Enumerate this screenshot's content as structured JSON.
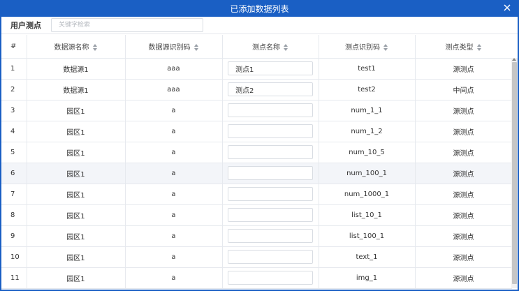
{
  "dialog": {
    "title": "已添加数据列表",
    "close_icon": "close-icon"
  },
  "toolbar": {
    "label": "用户测点",
    "search_placeholder": "关键字检索",
    "search_value": ""
  },
  "table": {
    "columns": [
      "#",
      "数据源名称",
      "数据源识别码",
      "测点名称",
      "测点识别码",
      "测点类型"
    ],
    "rows": [
      {
        "index": "1",
        "source_name": "数据源1",
        "source_code": "aaa",
        "point_name": "测点1",
        "point_code": "test1",
        "point_type": "源测点"
      },
      {
        "index": "2",
        "source_name": "数据源1",
        "source_code": "aaa",
        "point_name": "测点2",
        "point_code": "test2",
        "point_type": "中间点"
      },
      {
        "index": "3",
        "source_name": "园区1",
        "source_code": "a",
        "point_name": "",
        "point_code": "num_1_1",
        "point_type": "源测点"
      },
      {
        "index": "4",
        "source_name": "园区1",
        "source_code": "a",
        "point_name": "",
        "point_code": "num_1_2",
        "point_type": "源测点"
      },
      {
        "index": "5",
        "source_name": "园区1",
        "source_code": "a",
        "point_name": "",
        "point_code": "num_10_5",
        "point_type": "源测点"
      },
      {
        "index": "6",
        "source_name": "园区1",
        "source_code": "a",
        "point_name": "",
        "point_code": "num_100_1",
        "point_type": "源测点"
      },
      {
        "index": "7",
        "source_name": "园区1",
        "source_code": "a",
        "point_name": "",
        "point_code": "num_1000_1",
        "point_type": "源测点"
      },
      {
        "index": "8",
        "source_name": "园区1",
        "source_code": "a",
        "point_name": "",
        "point_code": "list_10_1",
        "point_type": "源测点"
      },
      {
        "index": "9",
        "source_name": "园区1",
        "source_code": "a",
        "point_name": "",
        "point_code": "list_100_1",
        "point_type": "源测点"
      },
      {
        "index": "10",
        "source_name": "园区1",
        "source_code": "a",
        "point_name": "",
        "point_code": "text_1",
        "point_type": "源测点"
      },
      {
        "index": "11",
        "source_name": "园区1",
        "source_code": "a",
        "point_name": "",
        "point_code": "img_1",
        "point_type": "源测点"
      }
    ],
    "highlighted_row": 6
  },
  "colors": {
    "accent": "#1a5fc4",
    "border": "#e6e9ee",
    "row_highlight": "#f3f5f9"
  }
}
